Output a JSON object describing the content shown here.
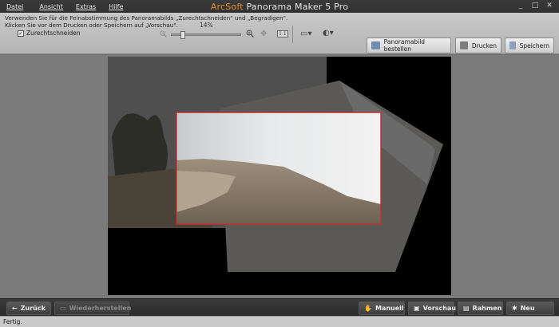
{
  "app": {
    "brand": "ArcSoft",
    "name": "Panorama Maker 5 Pro"
  },
  "menu": [
    {
      "label": "Datei"
    },
    {
      "label": "Ansicht"
    },
    {
      "label": "Extras"
    },
    {
      "label": "Hilfe"
    }
  ],
  "window_controls": {
    "minimize": "_",
    "maximize": "□",
    "close": "✕"
  },
  "instructions": {
    "line1": "Verwenden Sie für die Feinabstimmung des Panoramabilds „Zurechtschneiden\" und „Begradigen\".",
    "line2": "Klicken Sie vor dem Drucken oder Speichern auf „Vorschau\"."
  },
  "crop": {
    "label": "Zurechtschneiden",
    "checked": true
  },
  "zoom": {
    "percent_label": "14%",
    "value": 0.14,
    "one_to_one": "1:1"
  },
  "toolbar_buttons": {
    "order": "Panoramabild bestellen",
    "print": "Drucken",
    "save": "Speichern"
  },
  "bottom_buttons": {
    "back": "Zurück",
    "restore": "Wiederherstellen",
    "manual": "Manuell",
    "preview": "Vorschau",
    "frame": "Rahmen",
    "new": "Neu"
  },
  "status": "Fertig.",
  "colors": {
    "brand": "#e8902a",
    "crop_frame": "#c03030",
    "canvas": "#000000"
  }
}
